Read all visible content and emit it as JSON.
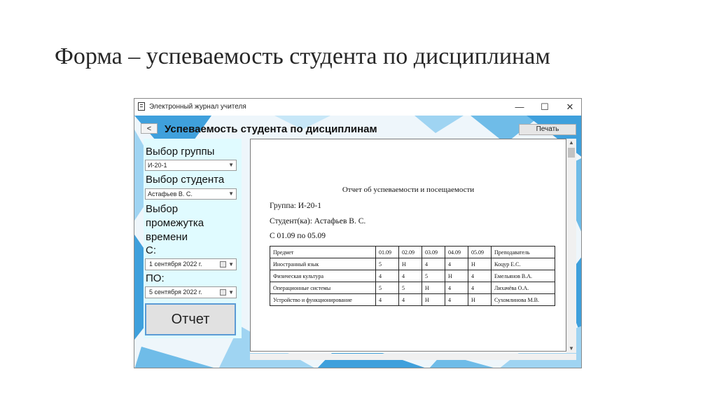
{
  "slide": {
    "title": "Форма – успеваемость студента по дисциплинам"
  },
  "window": {
    "title": "Электронный журнал учителя",
    "app_icon": "journal-icon",
    "minimize_glyph": "—",
    "maximize_glyph": "☐",
    "close_glyph": "✕"
  },
  "toolbar": {
    "back_label": "<",
    "title": "Успеваемость студента по дисциплинам",
    "print_label": "Печать"
  },
  "filters": {
    "group_label": "Выбор группы",
    "group_value": "И-20-1",
    "student_label": "Выбор студента",
    "student_value": "Астафьев В. С.",
    "period_label_1": "Выбор",
    "period_label_2": "промежутка",
    "period_label_3": "времени",
    "from_label": "С:",
    "from_value": "1 сентября 2022 г.",
    "to_label": "ПО:",
    "to_value": "5 сентября 2022 г.",
    "report_button": "Отчет"
  },
  "report": {
    "title": "Отчет об успеваемости и посещаемости",
    "group": "Группа: И-20-1",
    "student": "Студент(ка): Астафьев В. С.",
    "period": "С 01.09 по 05.09",
    "columns": [
      "Предмет",
      "01.09",
      "02.09",
      "03.09",
      "04.09",
      "05.09",
      "Преподаватель"
    ],
    "rows": [
      [
        "Иностранный язык",
        "5",
        "Н",
        "4",
        "4",
        "Н",
        "Коцур Е.С."
      ],
      [
        "Физическая культура",
        "4",
        "4",
        "5",
        "Н",
        "4",
        "Емельянов В.А."
      ],
      [
        "Операционные системы",
        "5",
        "5",
        "Н",
        "4",
        "4",
        "Лихачёва О.А."
      ],
      [
        "Устройство и функционирование",
        "4",
        "4",
        "Н",
        "4",
        "Н",
        "Сухомлинова М.В."
      ]
    ]
  },
  "colors": {
    "panel": "#e0fbff",
    "accent": "#5b9bd5",
    "deco_blue": "#3fa0dc",
    "deco_light": "#9fd4f2"
  }
}
